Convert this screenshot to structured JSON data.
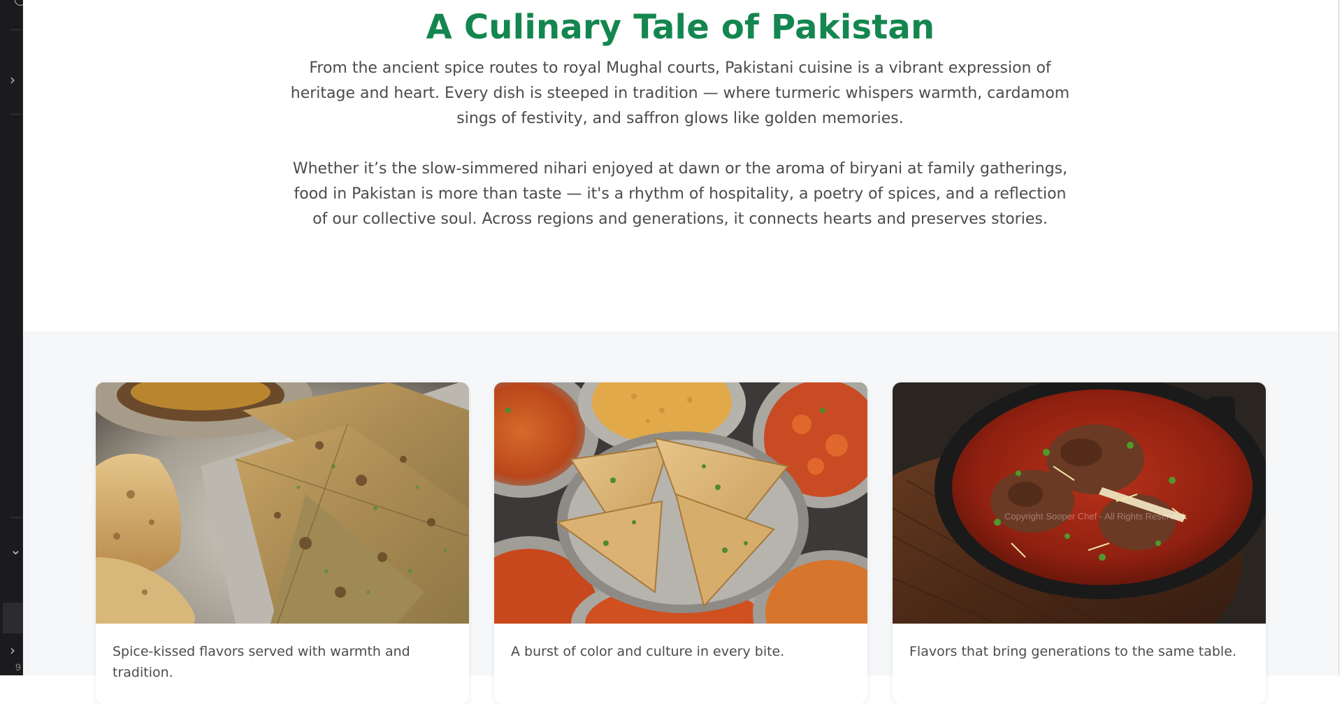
{
  "page": {
    "title": "A Culinary Tale of Pakistan",
    "paragraphs": [
      "From the ancient spice routes to royal Mughal courts, Pakistani cuisine is a vibrant expression of heritage and heart. Every dish is steeped in tradition — where turmeric whispers warmth, cardamom sings of festivity, and saffron glows like golden memories.",
      "Whether it’s the slow-simmered nihari enjoyed at dawn or the aroma of biryani at family gatherings, food in Pakistan is more than taste — it's a rhythm of hospitality, a poetry of spices, and a reflection of our collective soul. Across regions and generations, it connects hearts and preserves stories."
    ],
    "title_color": "#14864f"
  },
  "gallery": {
    "cards": [
      {
        "caption": "Spice-kissed flavors served with warmth and tradition."
      },
      {
        "caption": "A burst of color and culture in every bite."
      },
      {
        "caption": "Flavors that bring generations to the same table."
      }
    ],
    "watermark": "Copyright Sooper Chef - All Rights Reserved"
  },
  "editor_strip": {
    "icons": [
      "circle-icon",
      "chevron-right-icon",
      "chevron-down-icon",
      "chevron-right-icon"
    ],
    "line_number": "9"
  }
}
